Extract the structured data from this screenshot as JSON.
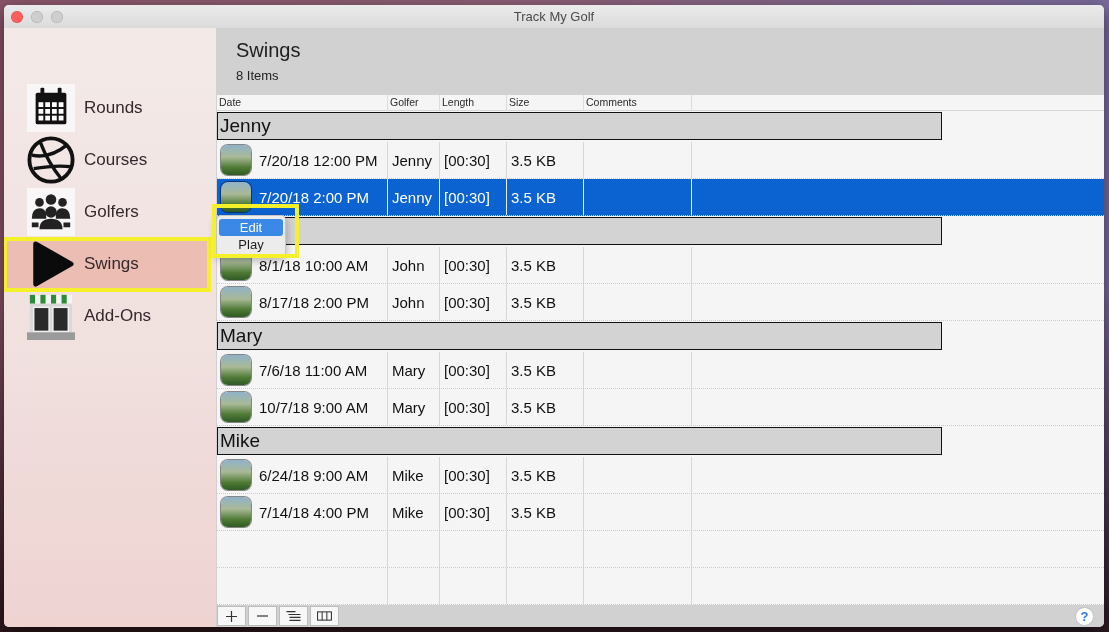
{
  "window": {
    "title": "Track My Golf",
    "controls": [
      {
        "kind": "close",
        "disabled": false
      },
      {
        "kind": "minimize",
        "disabled": true
      },
      {
        "kind": "zoom",
        "disabled": true
      }
    ]
  },
  "sidebar": {
    "items": [
      {
        "label": "Rounds",
        "kind": "calendar",
        "selected": false,
        "highlighted": false
      },
      {
        "label": "Courses",
        "kind": "globe",
        "selected": false,
        "highlighted": false
      },
      {
        "label": "Golfers",
        "kind": "people",
        "selected": false,
        "highlighted": false
      },
      {
        "label": "Swings",
        "kind": "play",
        "selected": true,
        "highlighted": true
      },
      {
        "label": "Add-Ons",
        "kind": "store",
        "selected": false,
        "highlighted": false
      }
    ]
  },
  "header": {
    "title": "Swings",
    "count": "8 Items"
  },
  "table": {
    "columns": [
      "Date",
      "Golfer",
      "Length",
      "Size",
      "Comments"
    ],
    "groups": [
      {
        "name": "Jenny",
        "rows": [
          {
            "date": "7/20/18 12:00 PM",
            "golfer": "Jenny",
            "length": "[00:30]",
            "size": "3.5 KB",
            "selected": false
          },
          {
            "date": "7/20/18 2:00 PM",
            "golfer": "Jenny",
            "length": "[00:30]",
            "size": "3.5 KB",
            "selected": true
          }
        ]
      },
      {
        "rows": [
          {
            "date": "8/1/18 10:00 AM",
            "golfer": "John",
            "length": "[00:30]",
            "size": "3.5 KB",
            "selected": false
          },
          {
            "date": "8/17/18 2:00 PM",
            "golfer": "John",
            "length": "[00:30]",
            "size": "3.5 KB",
            "selected": false
          }
        ]
      },
      {
        "name": "Mary",
        "rows": [
          {
            "date": "7/6/18 11:00 AM",
            "golfer": "Mary",
            "length": "[00:30]",
            "size": "3.5 KB",
            "selected": false
          },
          {
            "date": "10/7/18 9:00 AM",
            "golfer": "Mary",
            "length": "[00:30]",
            "size": "3.5 KB",
            "selected": false
          }
        ]
      },
      {
        "name": "Mike",
        "rows": [
          {
            "date": "6/24/18 9:00 AM",
            "golfer": "Mike",
            "length": "[00:30]",
            "size": "3.5 KB",
            "selected": false
          },
          {
            "date": "7/14/18 4:00 PM",
            "golfer": "Mike",
            "length": "[00:30]",
            "size": "3.5 KB",
            "selected": false
          }
        ]
      }
    ]
  },
  "context_menu": {
    "highlighted": true,
    "items": [
      {
        "label": "Edit",
        "selected": true
      },
      {
        "label": "Play",
        "selected": false
      }
    ]
  },
  "bottom_bar": {
    "buttons": [
      {
        "kind": "add"
      },
      {
        "kind": "remove"
      },
      {
        "kind": "list"
      },
      {
        "kind": "columns"
      }
    ],
    "help": "?"
  }
}
